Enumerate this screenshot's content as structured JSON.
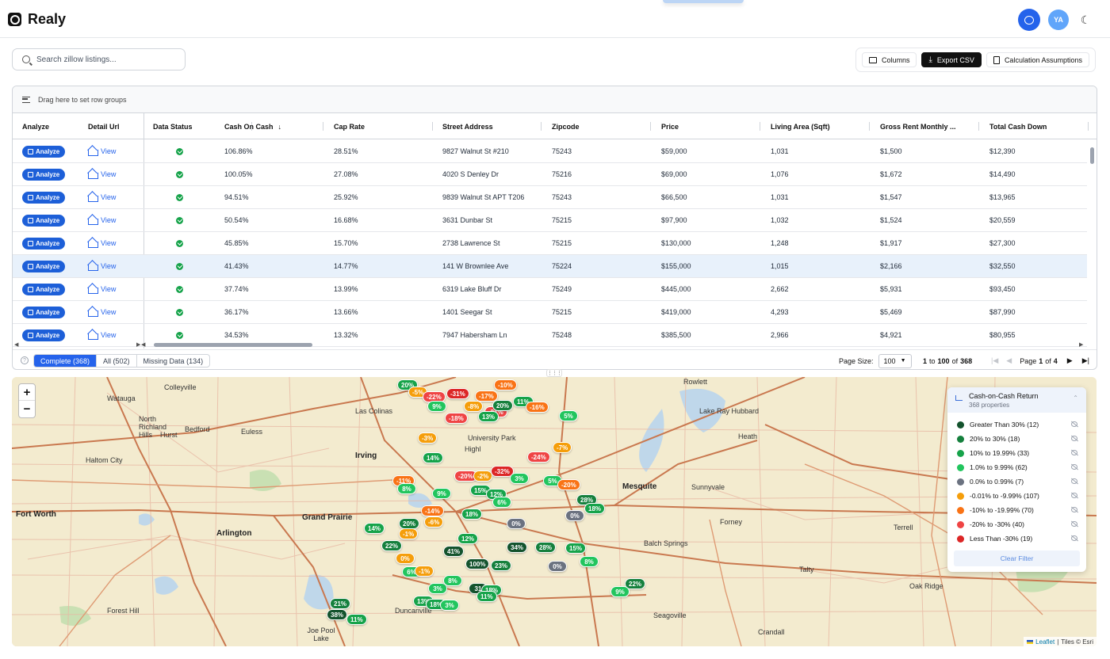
{
  "app": {
    "name": "Realy"
  },
  "header": {
    "avatar_initials": "YA",
    "icons": [
      "chat-icon",
      "moon-icon"
    ]
  },
  "search": {
    "placeholder": "Search zillow listings..."
  },
  "toolbar": {
    "columns_label": "Columns",
    "export_label": "Export CSV",
    "assumptions_label": "Calculation Assumptions"
  },
  "grid": {
    "group_hint": "Drag here to set row groups",
    "columns": [
      "Analyze",
      "Detail Url",
      "Data Status",
      "Cash On Cash",
      "Cap Rate",
      "Street Address",
      "Zipcode",
      "Price",
      "Living Area (Sqft)",
      "Gross Rent Monthly ...",
      "Total Cash Down"
    ],
    "sorted_column": "Cash On Cash",
    "sort_direction": "descending",
    "analyze_label": "Analyze",
    "view_label": "View",
    "rows": [
      {
        "coc": "106.86%",
        "cap": "28.51%",
        "address": "9827 Walnut St #210",
        "zip": "75243",
        "price": "$59,000",
        "area": "1,031",
        "rent": "$1,500",
        "cash": "$12,390"
      },
      {
        "coc": "100.05%",
        "cap": "27.08%",
        "address": "4020 S Denley Dr",
        "zip": "75216",
        "price": "$69,000",
        "area": "1,076",
        "rent": "$1,672",
        "cash": "$14,490"
      },
      {
        "coc": "94.51%",
        "cap": "25.92%",
        "address": "9839 Walnut St APT T206",
        "zip": "75243",
        "price": "$66,500",
        "area": "1,031",
        "rent": "$1,547",
        "cash": "$13,965"
      },
      {
        "coc": "50.54%",
        "cap": "16.68%",
        "address": "3631 Dunbar St",
        "zip": "75215",
        "price": "$97,900",
        "area": "1,032",
        "rent": "$1,524",
        "cash": "$20,559"
      },
      {
        "coc": "45.85%",
        "cap": "15.70%",
        "address": "2738 Lawrence St",
        "zip": "75215",
        "price": "$130,000",
        "area": "1,248",
        "rent": "$1,917",
        "cash": "$27,300"
      },
      {
        "coc": "41.43%",
        "cap": "14.77%",
        "address": "141 W Brownlee Ave",
        "zip": "75224",
        "price": "$155,000",
        "area": "1,015",
        "rent": "$2,166",
        "cash": "$32,550",
        "selected": true
      },
      {
        "coc": "37.74%",
        "cap": "13.99%",
        "address": "6319 Lake Bluff Dr",
        "zip": "75249",
        "price": "$445,000",
        "area": "2,662",
        "rent": "$5,931",
        "cash": "$93,450"
      },
      {
        "coc": "36.17%",
        "cap": "13.66%",
        "address": "1401 Seegar St",
        "zip": "75215",
        "price": "$419,000",
        "area": "4,293",
        "rent": "$5,469",
        "cash": "$87,990"
      },
      {
        "coc": "34.53%",
        "cap": "13.32%",
        "address": "7947 Habersham Ln",
        "zip": "75248",
        "price": "$385,500",
        "area": "2,966",
        "rent": "$4,921",
        "cash": "$80,955"
      }
    ],
    "filters": {
      "complete": "Complete (368)",
      "all": "All (502)",
      "missing": "Missing Data (134)"
    },
    "pagination": {
      "page_size_label": "Page Size:",
      "page_size": "100",
      "from": "1",
      "to_word": "to",
      "to": "100",
      "of_word": "of",
      "total": "368",
      "page_word": "Page",
      "page": "1",
      "page_of": "of",
      "pages": "4"
    }
  },
  "map": {
    "zoom_in": "+",
    "zoom_out": "−",
    "cities": [
      "Colleyville",
      "Watauga",
      "North Richland Hills",
      "Hurst",
      "Bedford",
      "Euless",
      "Haltom City",
      "Fort Worth",
      "Arlington",
      "Grand Prairie",
      "Irving",
      "Las Colinas",
      "Forest Hill",
      "Duncanville",
      "Joe Pool Lake",
      "Mesquite",
      "Sunnyvale",
      "Lake Ray Hubbard",
      "Heath",
      "Rowlett",
      "Forney",
      "Terrell",
      "Balch Springs",
      "Talty",
      "Oak Ridge",
      "Seagoville",
      "Crandall",
      "University Park",
      "Highl"
    ],
    "legend": {
      "title": "Cash-on-Cash Return",
      "subtitle": "368 properties",
      "items": [
        {
          "label": "Greater Than 30% (12)",
          "color": "#14532d"
        },
        {
          "label": "20% to 30% (18)",
          "color": "#15803d"
        },
        {
          "label": "10% to 19.99% (33)",
          "color": "#16a34a"
        },
        {
          "label": "1.0% to 9.99% (62)",
          "color": "#22c55e"
        },
        {
          "label": "0.0% to 0.99% (7)",
          "color": "#6b7280"
        },
        {
          "label": "-0.01% to -9.99% (107)",
          "color": "#f59e0b"
        },
        {
          "label": "-10% to -19.99% (70)",
          "color": "#f97316"
        },
        {
          "label": "-20% to -30% (40)",
          "color": "#ef4444"
        },
        {
          "label": "Less Than -30% (19)",
          "color": "#dc2626"
        }
      ],
      "clear_label": "Clear Filter"
    },
    "markers": [
      {
        "t": "20%",
        "c": "#16a34a"
      },
      {
        "t": "-5%",
        "c": "#f59e0b"
      },
      {
        "t": "-22%",
        "c": "#ef4444"
      },
      {
        "t": "-31%",
        "c": "#dc2626"
      },
      {
        "t": "-17%",
        "c": "#f97316"
      },
      {
        "t": "-10%",
        "c": "#f97316"
      },
      {
        "t": "9%",
        "c": "#22c55e"
      },
      {
        "t": "-8%",
        "c": "#f59e0b"
      },
      {
        "t": "-21%",
        "c": "#ef4444"
      },
      {
        "t": "11%",
        "c": "#16a34a"
      },
      {
        "t": "-16%",
        "c": "#f97316"
      },
      {
        "t": "-18%",
        "c": "#ef4444"
      },
      {
        "t": "20%",
        "c": "#15803d"
      },
      {
        "t": "5%",
        "c": "#22c55e"
      },
      {
        "t": "-3%",
        "c": "#f59e0b"
      },
      {
        "t": "13%",
        "c": "#16a34a"
      },
      {
        "t": "-7%",
        "c": "#f59e0b"
      },
      {
        "t": "-24%",
        "c": "#ef4444"
      },
      {
        "t": "14%",
        "c": "#16a34a"
      },
      {
        "t": "-20%",
        "c": "#ef4444"
      },
      {
        "t": "-2%",
        "c": "#f59e0b"
      },
      {
        "t": "-32%",
        "c": "#dc2626"
      },
      {
        "t": "3%",
        "c": "#22c55e"
      },
      {
        "t": "5%",
        "c": "#22c55e"
      },
      {
        "t": "-20%",
        "c": "#f97316"
      },
      {
        "t": "-11%",
        "c": "#f97316"
      },
      {
        "t": "8%",
        "c": "#22c55e"
      },
      {
        "t": "9%",
        "c": "#22c55e"
      },
      {
        "t": "15%",
        "c": "#16a34a"
      },
      {
        "t": "12%",
        "c": "#16a34a"
      },
      {
        "t": "-14%",
        "c": "#f97316"
      },
      {
        "t": "6%",
        "c": "#22c55e"
      },
      {
        "t": "28%",
        "c": "#15803d"
      },
      {
        "t": "18%",
        "c": "#16a34a"
      },
      {
        "t": "18%",
        "c": "#16a34a"
      },
      {
        "t": "0%",
        "c": "#6b7280"
      },
      {
        "t": "0%",
        "c": "#6b7280"
      },
      {
        "t": "14%",
        "c": "#16a34a"
      },
      {
        "t": "20%",
        "c": "#15803d"
      },
      {
        "t": "-6%",
        "c": "#f59e0b"
      },
      {
        "t": "-1%",
        "c": "#f59e0b"
      },
      {
        "t": "12%",
        "c": "#16a34a"
      },
      {
        "t": "22%",
        "c": "#15803d"
      },
      {
        "t": "41%",
        "c": "#14532d"
      },
      {
        "t": "34%",
        "c": "#14532d"
      },
      {
        "t": "28%",
        "c": "#15803d"
      },
      {
        "t": "15%",
        "c": "#16a34a"
      },
      {
        "t": "0%",
        "c": "#f59e0b"
      },
      {
        "t": "100%",
        "c": "#14532d"
      },
      {
        "t": "6%",
        "c": "#22c55e"
      },
      {
        "t": "-1%",
        "c": "#f59e0b"
      },
      {
        "t": "23%",
        "c": "#15803d"
      },
      {
        "t": "0%",
        "c": "#6b7280"
      },
      {
        "t": "8%",
        "c": "#22c55e"
      },
      {
        "t": "3%",
        "c": "#22c55e"
      },
      {
        "t": "8%",
        "c": "#22c55e"
      },
      {
        "t": "31",
        "c": "#14532d"
      },
      {
        "t": "18%",
        "c": "#16a34a"
      },
      {
        "t": "22%",
        "c": "#15803d"
      },
      {
        "t": "9%",
        "c": "#22c55e"
      },
      {
        "t": "11%",
        "c": "#16a34a"
      },
      {
        "t": "13%",
        "c": "#16a34a"
      },
      {
        "t": "18%",
        "c": "#16a34a"
      },
      {
        "t": "3%",
        "c": "#22c55e"
      },
      {
        "t": "21%",
        "c": "#15803d"
      },
      {
        "t": "38%",
        "c": "#14532d"
      },
      {
        "t": "11%",
        "c": "#16a34a"
      }
    ],
    "attribution": {
      "leaflet": "Leaflet",
      "sep": "|",
      "tiles": "Tiles © Esri"
    }
  }
}
